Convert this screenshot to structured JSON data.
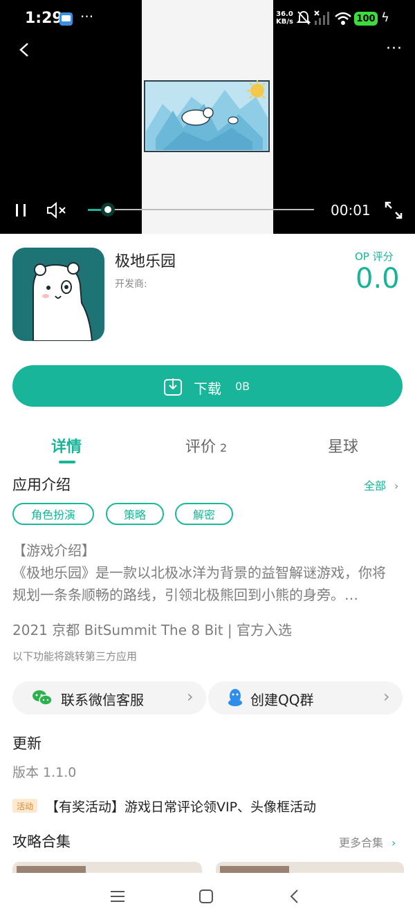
{
  "status_bar": {
    "time": "1:29",
    "speed_value": "36.0",
    "speed_unit": "KB/s",
    "battery": "100"
  },
  "video": {
    "current_time": "00:01",
    "progress_fraction": 0.1
  },
  "app": {
    "name": "极地乐园",
    "developer_label": "开发商:",
    "rating_label": "OP 评分",
    "rating_value": "0.0"
  },
  "download": {
    "label": "下载",
    "size": "0B"
  },
  "tabs": [
    {
      "label": "详情",
      "active": true
    },
    {
      "label": "评价",
      "count": "2"
    },
    {
      "label": "星球"
    }
  ],
  "intro": {
    "title": "应用介绍",
    "all_link": "全部",
    "tags": [
      "角色扮演",
      "策略",
      "解密"
    ],
    "description_heading": "【游戏介绍】",
    "description_line_1": "《极地乐园》是一款以北极冰洋为背景的益智解谜游戏，你将",
    "description_line_2": "规划一条条顺畅的路线，引领北极熊回到小熊的身旁。…",
    "award": "2021 京都 BitSummit The 8 Bit | 官方入选",
    "third_party_notice": "以下功能将跳转第三方应用"
  },
  "contact": {
    "wechat": "联系微信客服",
    "qq": "创建QQ群"
  },
  "update": {
    "title": "更新",
    "version": "版本 1.1.0"
  },
  "activity": {
    "badge": "活动",
    "text": "【有奖活动】游戏日常评论领VIP、头像框活动"
  },
  "guides": {
    "title": "攻略合集",
    "more": "更多合集"
  },
  "colors": {
    "accent": "#18b59b",
    "icon_bg": "#1e7375"
  }
}
